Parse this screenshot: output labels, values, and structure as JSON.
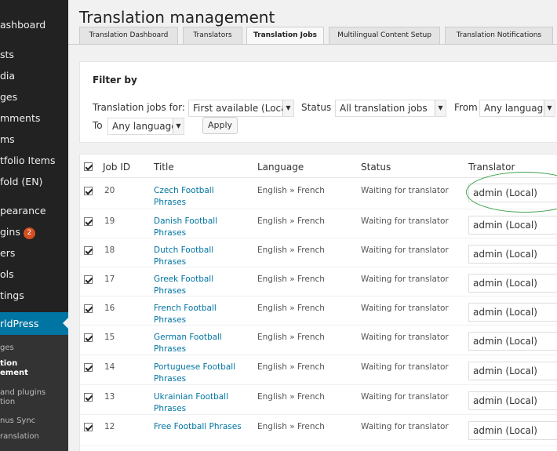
{
  "sidebar": {
    "items": [
      {
        "label": "ashboard"
      },
      {
        "label": "sts"
      },
      {
        "label": "dia"
      },
      {
        "label": "ges"
      },
      {
        "label": "mments"
      },
      {
        "label": "ms"
      },
      {
        "label": "tfolio Items"
      },
      {
        "label": "fold (EN)"
      },
      {
        "label": "pearance"
      },
      {
        "label": "gins",
        "badge": "2"
      },
      {
        "label": "ers"
      },
      {
        "label": "ols"
      },
      {
        "label": "tings"
      },
      {
        "label": "rldPress",
        "active": true
      }
    ],
    "submenu": [
      {
        "label": "ges"
      },
      {
        "label": "tion\nement",
        "current": true
      },
      {
        "label": "and plugins\ntion"
      },
      {
        "label": "nus Sync"
      },
      {
        "label": "ranslation"
      }
    ]
  },
  "page": {
    "title": "Translation management"
  },
  "tabs": [
    {
      "label": "Translation Dashboard"
    },
    {
      "label": "Translators"
    },
    {
      "label": "Translation Jobs",
      "active": true
    },
    {
      "label": "Multilingual Content Setup"
    },
    {
      "label": "Translation Notifications"
    }
  ],
  "filter": {
    "title": "Filter by",
    "jobs_for_label": "Translation jobs for:",
    "jobs_for_value": "First available (Local)",
    "status_label": "Status",
    "status_value": "All translation jobs",
    "from_label": "From",
    "from_value": "Any language",
    "to_label": "To",
    "to_value": "Any language",
    "apply_label": "Apply"
  },
  "table": {
    "headers": {
      "job_id": "Job ID",
      "title": "Title",
      "language": "Language",
      "status": "Status",
      "translator": "Translator"
    },
    "rows": [
      {
        "job_id": "20",
        "title": "Czech Football Phrases",
        "language": "English » French",
        "status": "Waiting for translator",
        "translator": "admin (Local)"
      },
      {
        "job_id": "19",
        "title": "Danish Football Phrases",
        "language": "English » French",
        "status": "Waiting for translator",
        "translator": "admin (Local)"
      },
      {
        "job_id": "18",
        "title": "Dutch Football Phrases",
        "language": "English » French",
        "status": "Waiting for translator",
        "translator": "admin (Local)"
      },
      {
        "job_id": "17",
        "title": "Greek Football Phrases",
        "language": "English » French",
        "status": "Waiting for translator",
        "translator": "admin (Local)"
      },
      {
        "job_id": "16",
        "title": "French Football Phrases",
        "language": "English » French",
        "status": "Waiting for translator",
        "translator": "admin (Local)"
      },
      {
        "job_id": "15",
        "title": "German Football Phrases",
        "language": "English » French",
        "status": "Waiting for translator",
        "translator": "admin (Local)"
      },
      {
        "job_id": "14",
        "title": "Portuguese Football Phrases",
        "language": "English » French",
        "status": "Waiting for translator",
        "translator": "admin (Local)"
      },
      {
        "job_id": "13",
        "title": "Ukrainian Football Phrases",
        "language": "English » French",
        "status": "Waiting for translator",
        "translator": "admin (Local)"
      },
      {
        "job_id": "12",
        "title": "Free Football Phrases",
        "language": "English » French",
        "status": "Waiting for translator",
        "translator": "admin (Local)"
      }
    ]
  },
  "colors": {
    "sidebar_bg": "#222222",
    "active_menu": "#0074a2",
    "link": "#0074a2",
    "badge": "#d54e21",
    "highlight": "#3ea34d"
  }
}
